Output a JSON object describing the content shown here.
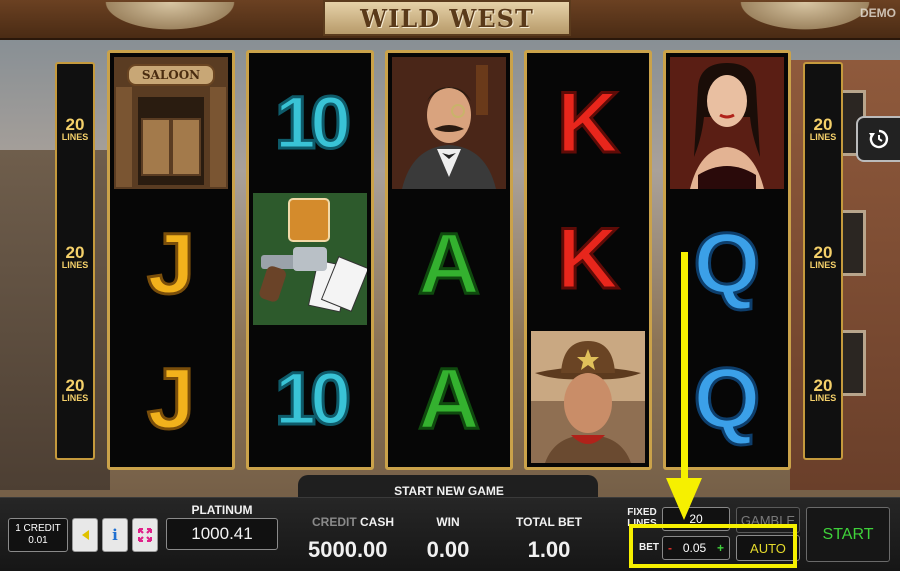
{
  "header": {
    "title": "WILD WEST",
    "demo_label": "DEMO"
  },
  "line_markers": {
    "value": "20",
    "label": "LINES"
  },
  "reels": [
    {
      "symbols": [
        "saloon",
        "J",
        "J"
      ]
    },
    {
      "symbols": [
        "10",
        "whiskey-revolver-cards",
        "10"
      ]
    },
    {
      "symbols": [
        "gentleman",
        "A",
        "A"
      ]
    },
    {
      "symbols": [
        "K",
        "K",
        "sheriff"
      ]
    },
    {
      "symbols": [
        "lady",
        "Q",
        "Q"
      ]
    }
  ],
  "saloon_sign": "SALOON",
  "panel": {
    "credit_value": "1 CREDIT",
    "credit_sub": "0.01",
    "jackpot_label": "PLATINUM JACKPOT",
    "jackpot_value": "1000.41",
    "start_new_game": "START NEW GAME",
    "credit_label_a": "CREDIT",
    "credit_label_b": "CASH",
    "cash_value": "5000.00",
    "win_label": "WIN",
    "win_value": "0.00",
    "total_bet_label": "TOTAL BET",
    "total_bet_value": "1.00",
    "fixed_lines_label": "FIXED LINES",
    "fixed_lines_value": "20",
    "bet_label": "BET",
    "bet_minus": "-",
    "bet_value": "0.05",
    "bet_plus": "+",
    "gamble_label": "GAMBLE",
    "auto_label": "AUTO",
    "start_label": "START"
  },
  "colors": {
    "gold": "#caa24a",
    "highlight": "#f6f000",
    "start_green": "#3fd13a",
    "auto_yellow": "#e6dc2c"
  }
}
